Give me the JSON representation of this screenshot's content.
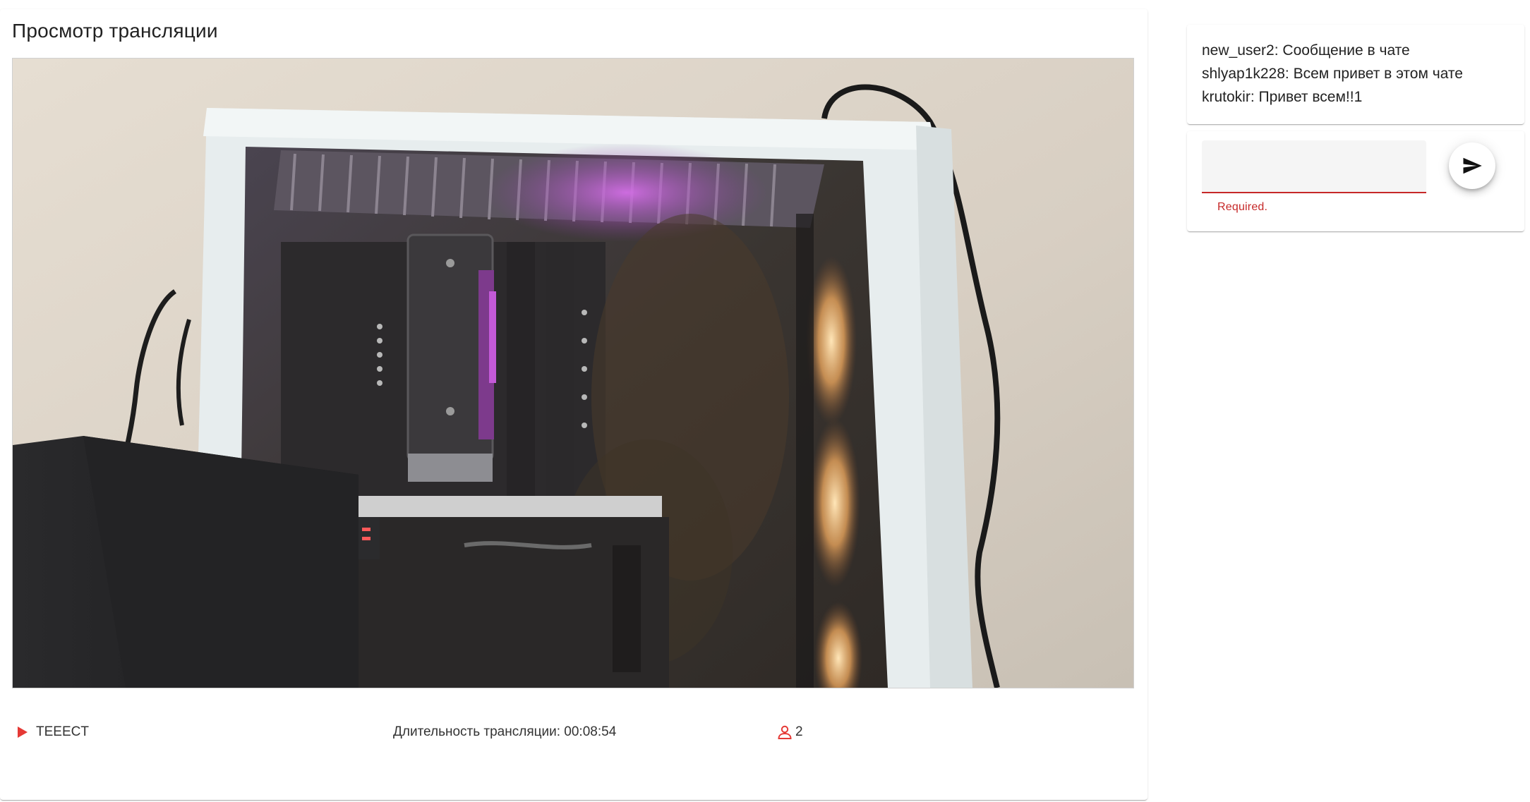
{
  "stream": {
    "title": "Просмотр трансляции",
    "name": "TEEECT",
    "duration_label": "Длительность трансляции:",
    "duration_value": "00:08:54",
    "viewer_count": "2"
  },
  "chat": {
    "messages": [
      "new_user2: Сообщение в чате",
      "shlyap1k228: Всем привет в этом чате",
      "krutokir: Привет всем!!1"
    ],
    "input_value": "",
    "error_text": "Required."
  },
  "colors": {
    "accent": "#e53935",
    "error": "#c62828"
  },
  "icons": {
    "stream_status": "play-icon",
    "viewers": "person-icon",
    "send": "send-icon"
  }
}
